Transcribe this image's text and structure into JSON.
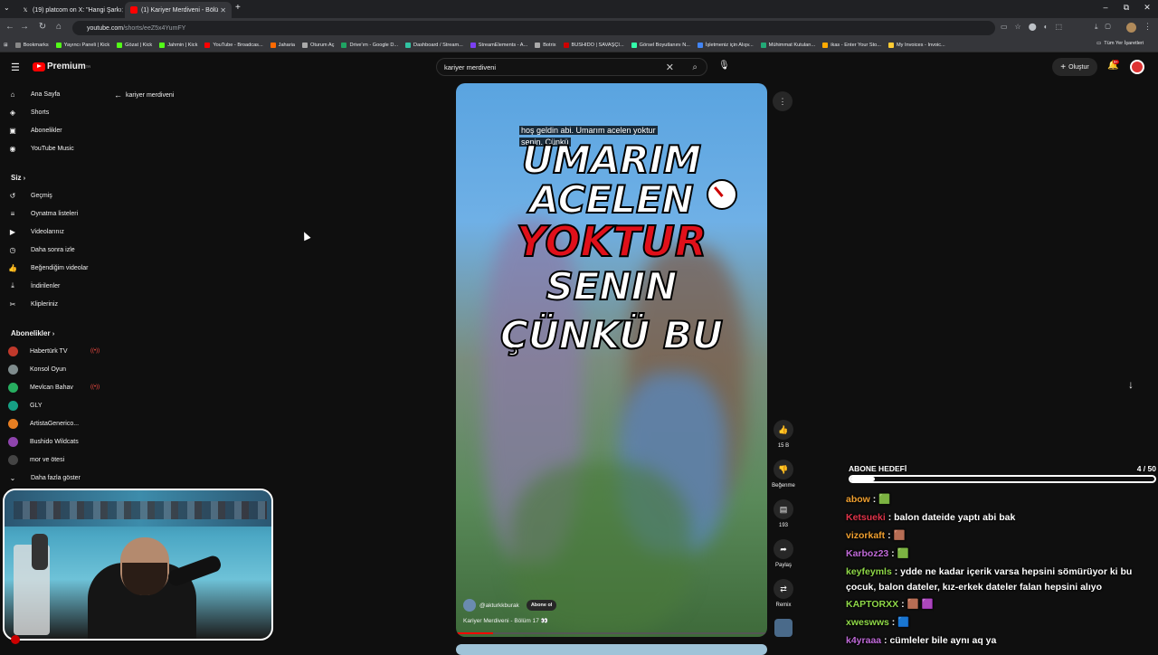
{
  "browser": {
    "tabs": [
      {
        "label": "(19) platcom on X: \"Hangi Şarkı",
        "active": false
      },
      {
        "label": "(1) Kariyer Merdiveni - Bölü",
        "active": true
      }
    ],
    "url_host": "youtube.com",
    "url_path": "/shorts/eeZ5x4YumFY",
    "bookmarks": [
      "Bookmarks",
      "Yayıncı Paneli | Kick",
      "Gözat | Kick",
      "Jahmin | Kick",
      "YouTube - Broadcas...",
      "Jaharia",
      "Oturum Aç",
      "Drive'ım - Google D...",
      "Dashboard / Stream...",
      "StreamElements - A...",
      "Botrix",
      "BUSHIDO | SAVAŞÇI...",
      "Görsel Boyutlanını N...",
      "İşletmeniz için Alışv...",
      "Mühimmat Kutuları...",
      "ikas - Enter Your Sto...",
      "My Invoices - Invoic..."
    ],
    "all_bookmarks": "Tüm Yer İşaretleri"
  },
  "youtube": {
    "logo": "Premium",
    "logo_sup": "TR",
    "search_value": "kariyer merdiveni",
    "back_label": "kariyer merdiveni",
    "create_label": "Oluştur",
    "notif_count": "9+",
    "sidebar_main": [
      "Ana Sayfa",
      "Shorts",
      "Abonelikler",
      "YouTube Music"
    ],
    "you_header": "Siz",
    "sidebar_you": [
      "Geçmiş",
      "Oynatma listeleri",
      "Videolarınız",
      "Daha sonra izle",
      "Beğendiğim videolar",
      "İndirilenler",
      "Klipleriniz"
    ],
    "subs_header": "Abonelikler",
    "subscriptions": [
      {
        "name": "Habertürk TV",
        "color": "#c0392b",
        "live": true
      },
      {
        "name": "Konsol Oyun",
        "color": "#7f8c8d",
        "live": false
      },
      {
        "name": "Mevlcan Bahav",
        "color": "#27ae60",
        "live": true
      },
      {
        "name": "GLY",
        "color": "#16a085",
        "live": false
      },
      {
        "name": "ArtistaGenerico...",
        "color": "#e67e22",
        "live": false
      },
      {
        "name": "Bushido Wildcats",
        "color": "#8e44ad",
        "live": false
      },
      {
        "name": "mor ve ötesi",
        "color": "#444",
        "live": false
      }
    ],
    "show_more": "Daha fazla göster"
  },
  "short": {
    "caption_line1": "hoş geldin abi. Umarım acelen yoktur",
    "caption_line2": "senin. Çünkü",
    "big_lines": [
      "UMARIM",
      "ACELEN",
      "YOKTUR",
      "SENIN",
      "ÇÜNKÜ BU"
    ],
    "channel": "@akturkkburak",
    "subscribe": "Abone ol",
    "title": "Kariyer Merdiveni - Bölüm 17 👀",
    "like_count": "15 B",
    "dislike_label": "Beğenme",
    "comment_count": "193",
    "share_label": "Paylaş",
    "remix_label": "Remix"
  },
  "overlay": {
    "goal_label": "ABONE HEDEFİ",
    "goal_value": "4 / 50",
    "goal_progress": 0.08,
    "chat": [
      {
        "user": "abow",
        "color": "#f0a030",
        "msg": "🟩"
      },
      {
        "user": "Ketsueki",
        "color": "#e0344a",
        "msg": "balon dateide yaptı abi bak"
      },
      {
        "user": "vizorkaft",
        "color": "#f0a030",
        "msg": "🟫"
      },
      {
        "user": "Karboz23",
        "color": "#c06ad8",
        "msg": "🟩"
      },
      {
        "user": "keyfeymls",
        "color": "#8fd848",
        "msg": "ydde ne kadar içerik varsa hepsini sömürüyor ki bu çocuk, balon dateler, kız-erkek dateler falan hepsini alıyo"
      },
      {
        "user": "KAPTORXX",
        "color": "#8fd848",
        "msg": "🟫 🟪"
      },
      {
        "user": "xweswws",
        "color": "#8fd848",
        "msg": "🟦"
      },
      {
        "user": "k4yraaa",
        "color": "#c06ad8",
        "msg": "cümleler bile aynı aq ya"
      }
    ]
  }
}
